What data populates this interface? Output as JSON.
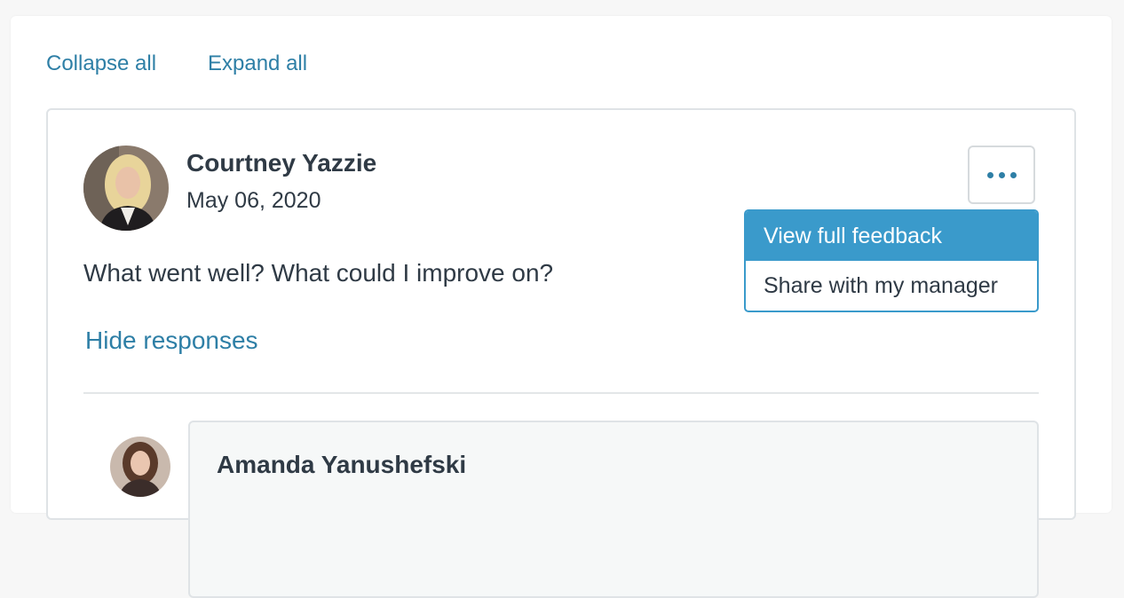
{
  "toolbar": {
    "collapse_all": "Collapse all",
    "expand_all": "Expand all"
  },
  "feedback": {
    "author_name": "Courtney Yazzie",
    "date": "May 06, 2020",
    "question": "What went well? What could I improve on?",
    "hide_responses": "Hide responses",
    "avatar_icon": "user-photo-avatar"
  },
  "menu": {
    "trigger_icon": "ellipsis-icon",
    "items": [
      {
        "label": "View full feedback",
        "highlighted": true
      },
      {
        "label": "Share with my manager",
        "highlighted": false
      }
    ]
  },
  "response": {
    "author_name": "Amanda Yanushefski",
    "avatar_icon": "user-photo-avatar"
  },
  "colors": {
    "link": "#2e7fa6",
    "menu_highlight": "#3a9acb",
    "text": "#2f3a45",
    "border": "#dfe3e6"
  }
}
